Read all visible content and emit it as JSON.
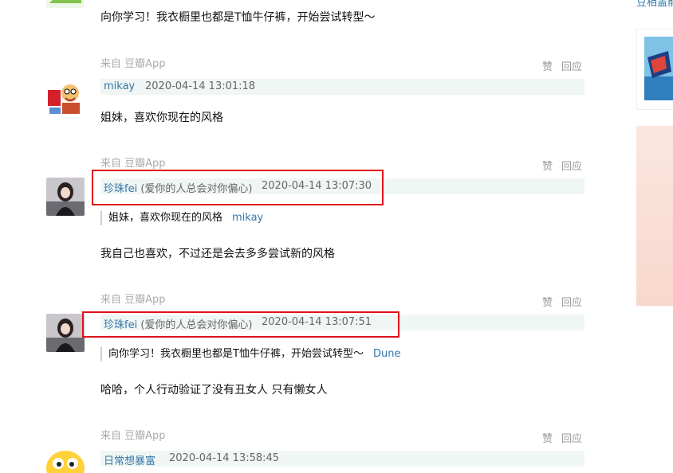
{
  "colors": {
    "link": "#3377aa",
    "meta_bg": "#f0f6f3",
    "highlight": "#e0111b"
  },
  "top": {
    "text": "向你学习！我衣橱里也都是T恤牛仔裤，开始尝试转型～"
  },
  "actions": {
    "like": "赞",
    "reply": "回应"
  },
  "comments": [
    {
      "source": "来自 豆瓣App",
      "author": "mikay",
      "signature": "",
      "time": "2020-04-14 13:01:18",
      "text": "姐妹，喜欢你现在的风格",
      "avatar_icon": "cartoon-face-avatar"
    },
    {
      "source": "来自 豆瓣App",
      "author": "珍珠fei",
      "signature": "(爱你的人总会对你偏心)",
      "time": "2020-04-14 13:07:30",
      "quote": {
        "text": "姐妹，喜欢你现在的风格",
        "author": "mikay"
      },
      "text": "我自己也喜欢，不过还是会去多多尝试新的风格",
      "avatar_icon": "girl-photo-avatar"
    },
    {
      "source": "来自 豆瓣App",
      "author": "珍珠fei",
      "signature": "(爱你的人总会对你偏心)",
      "time": "2020-04-14 13:07:51",
      "quote": {
        "text": "向你学习！我衣橱里也都是T恤牛仔裤，开始尝试转型～",
        "author": "Dune"
      },
      "text": "哈哈，个人行动验证了没有丑女人 只有懒女人",
      "avatar_icon": "girl-photo-avatar"
    },
    {
      "source": "来自 豆瓣App",
      "author": "日常想暴富",
      "signature": "",
      "time": "2020-04-14 13:58:45",
      "avatar_icon": "emoji-face-avatar"
    }
  ],
  "sidebar": {
    "top_link": "豆相盖前"
  }
}
